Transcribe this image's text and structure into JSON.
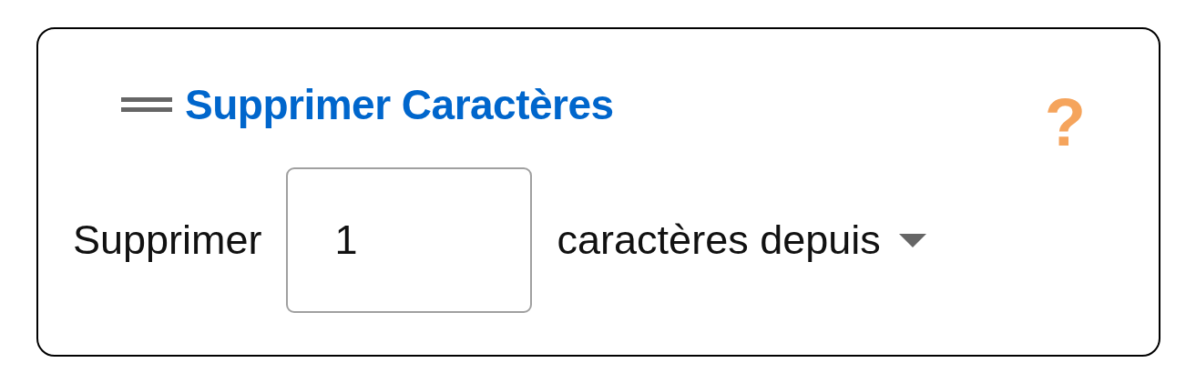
{
  "block": {
    "title": "Supprimer Caractères",
    "help": "?",
    "label": "Supprimer",
    "input": {
      "value": "1"
    },
    "dropdown": {
      "label": "caractères depuis"
    }
  }
}
